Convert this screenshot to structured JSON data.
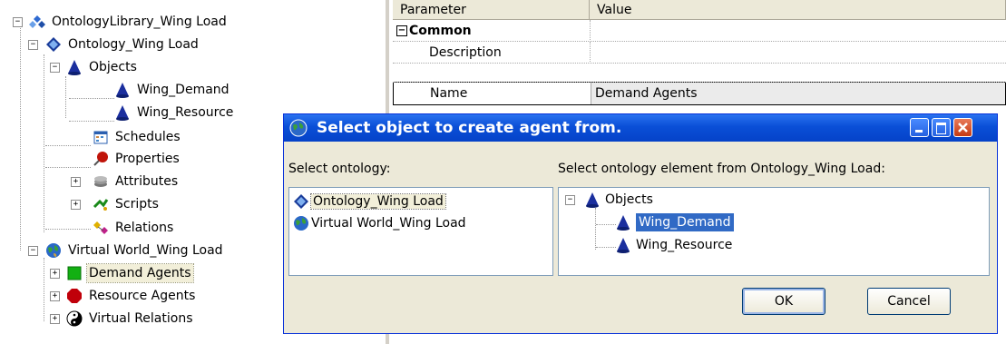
{
  "tree": {
    "root": "OntologyLibrary_Wing Load",
    "ontology": "Ontology_Wing Load",
    "objects": "Objects",
    "wing_demand": "Wing_Demand",
    "wing_resource": "Wing_Resource",
    "schedules": "Schedules",
    "properties": "Properties",
    "attributes": "Attributes",
    "scripts": "Scripts",
    "relations": "Relations",
    "virtual_world": "Virtual World_Wing Load",
    "demand_agents": "Demand Agents",
    "resource_agents": "Resource Agents",
    "virtual_relations": "Virtual Relations"
  },
  "grid": {
    "col_parameter": "Parameter",
    "col_value": "Value",
    "section_common": "Common",
    "rows": [
      {
        "param": "Description",
        "value": ""
      },
      {
        "param": "Name",
        "value": "Demand Agents"
      }
    ]
  },
  "dialog": {
    "title": "Select object to create agent from.",
    "left_label": "Select ontology:",
    "right_label": "Select ontology element from Ontology_Wing Load:",
    "ontologies": [
      "Ontology_Wing Load",
      "Virtual World_Wing Load"
    ],
    "tree_objects": "Objects",
    "tree_demand": "Wing_Demand",
    "tree_resource": "Wing_Resource",
    "ok": "OK",
    "cancel": "Cancel"
  },
  "colors": {
    "titlebar": "#0a4fd7",
    "selection": "#316ac5",
    "dialog_bg": "#ece9d8"
  }
}
